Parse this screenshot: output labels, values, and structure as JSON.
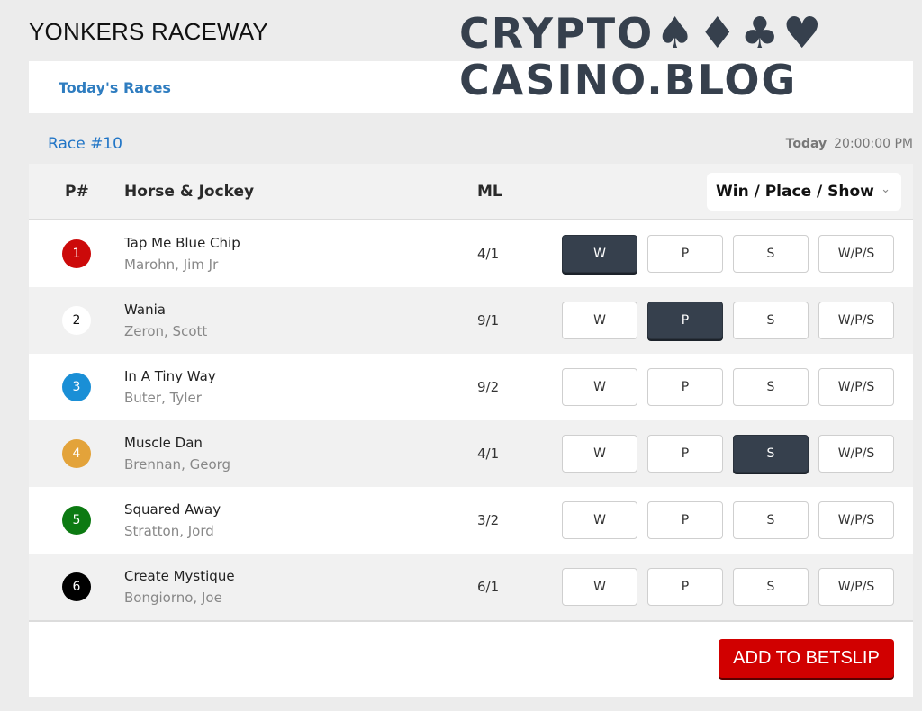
{
  "header": {
    "track_title": "YONKERS RACEWAY",
    "logo": {
      "line1": "CRYPTO",
      "suits": [
        "♠",
        "♦",
        "♣",
        "♥"
      ],
      "line2": "CASINO.BLOG"
    }
  },
  "nav": {
    "todays_races_label": "Today's Races"
  },
  "race": {
    "label": "Race #10",
    "day": "Today",
    "time": "20:00:00 PM"
  },
  "table": {
    "columns": {
      "post": "P#",
      "horse_jockey": "Horse & Jockey",
      "ml": "ML"
    },
    "bet_type_select": {
      "selected": "Win / Place / Show",
      "chevron": "⌄"
    },
    "bet_labels": [
      "W",
      "P",
      "S",
      "W/P/S"
    ],
    "rows": [
      {
        "post": "1",
        "post_color": "#cc0a0a",
        "post_text_color": "#ffffff",
        "horse": "Tap Me Blue Chip",
        "jockey": "Marohn, Jim Jr",
        "ml": "4/1",
        "selected_bet": "W"
      },
      {
        "post": "2",
        "post_color": "#ffffff",
        "post_text_color": "#111111",
        "horse": "Wania",
        "jockey": "Zeron, Scott",
        "ml": "9/1",
        "selected_bet": "P"
      },
      {
        "post": "3",
        "post_color": "#1a8fd6",
        "post_text_color": "#ffffff",
        "horse": "In A Tiny Way",
        "jockey": "Buter, Tyler",
        "ml": "9/2",
        "selected_bet": null
      },
      {
        "post": "4",
        "post_color": "#e3a33a",
        "post_text_color": "#ffffff",
        "horse": "Muscle Dan",
        "jockey": "Brennan, Georg",
        "ml": "4/1",
        "selected_bet": "S"
      },
      {
        "post": "5",
        "post_color": "#0c7a12",
        "post_text_color": "#ffffff",
        "horse": "Squared Away",
        "jockey": "Stratton, Jord",
        "ml": "3/2",
        "selected_bet": null
      },
      {
        "post": "6",
        "post_color": "#000000",
        "post_text_color": "#ffffff",
        "horse": "Create Mystique",
        "jockey": "Bongiorno, Joe",
        "ml": "6/1",
        "selected_bet": null
      }
    ]
  },
  "footer": {
    "add_to_betslip_label": "ADD TO BETSLIP",
    "add_button_color": "#d10000"
  }
}
